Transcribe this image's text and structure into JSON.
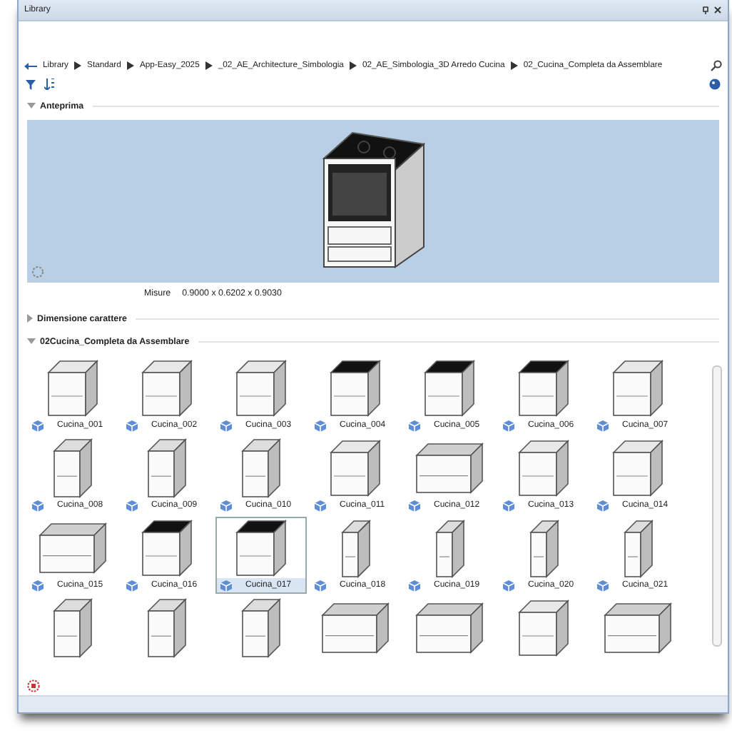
{
  "window": {
    "title": "Library"
  },
  "breadcrumb": [
    "Library",
    "Standard",
    "App-Easy_2025",
    "_02_AE_Architecture_Simbologia",
    "02_AE_Simbologia_3D Arredo Cucina",
    "02_Cucina_Completa da Assemblare"
  ],
  "sections": [
    {
      "title": "Anteprima",
      "expanded": true
    },
    {
      "title": "Dimensione carattere",
      "expanded": false
    },
    {
      "title": "02Cucina_Completa da Assemblare",
      "expanded": true
    }
  ],
  "preview": {
    "label": "Misure",
    "value": "0.9000 x 0.6202 x 0.9030"
  },
  "items": [
    {
      "label": "Cucina_001",
      "kind": "base",
      "selected": false
    },
    {
      "label": "Cucina_002",
      "kind": "base",
      "selected": false
    },
    {
      "label": "Cucina_003",
      "kind": "base",
      "selected": false
    },
    {
      "label": "Cucina_004",
      "kind": "cooktop",
      "selected": false
    },
    {
      "label": "Cucina_005",
      "kind": "cooktop",
      "selected": false
    },
    {
      "label": "Cucina_006",
      "kind": "cooktop",
      "selected": false
    },
    {
      "label": "Cucina_007",
      "kind": "base",
      "selected": false
    },
    {
      "label": "Cucina_008",
      "kind": "narrow",
      "selected": false
    },
    {
      "label": "Cucina_009",
      "kind": "narrow",
      "selected": false
    },
    {
      "label": "Cucina_010",
      "kind": "narrow",
      "selected": false
    },
    {
      "label": "Cucina_011",
      "kind": "base",
      "selected": false
    },
    {
      "label": "Cucina_012",
      "kind": "wide",
      "selected": false
    },
    {
      "label": "Cucina_013",
      "kind": "base",
      "selected": false
    },
    {
      "label": "Cucina_014",
      "kind": "base",
      "selected": false
    },
    {
      "label": "Cucina_015",
      "kind": "wide",
      "selected": false
    },
    {
      "label": "Cucina_016",
      "kind": "cooktop",
      "selected": false
    },
    {
      "label": "Cucina_017",
      "kind": "cooktop",
      "selected": true
    },
    {
      "label": "Cucina_018",
      "kind": "tall",
      "selected": false
    },
    {
      "label": "Cucina_019",
      "kind": "tall",
      "selected": false
    },
    {
      "label": "Cucina_020",
      "kind": "tall",
      "selected": false
    },
    {
      "label": "Cucina_021",
      "kind": "tall",
      "selected": false
    },
    {
      "kind": "narrow",
      "selected": false
    },
    {
      "kind": "narrow",
      "selected": false
    },
    {
      "kind": "narrow",
      "selected": false
    },
    {
      "kind": "wide",
      "selected": false
    },
    {
      "kind": "wide",
      "selected": false
    },
    {
      "kind": "base",
      "selected": false
    },
    {
      "kind": "wide",
      "selected": false
    }
  ]
}
